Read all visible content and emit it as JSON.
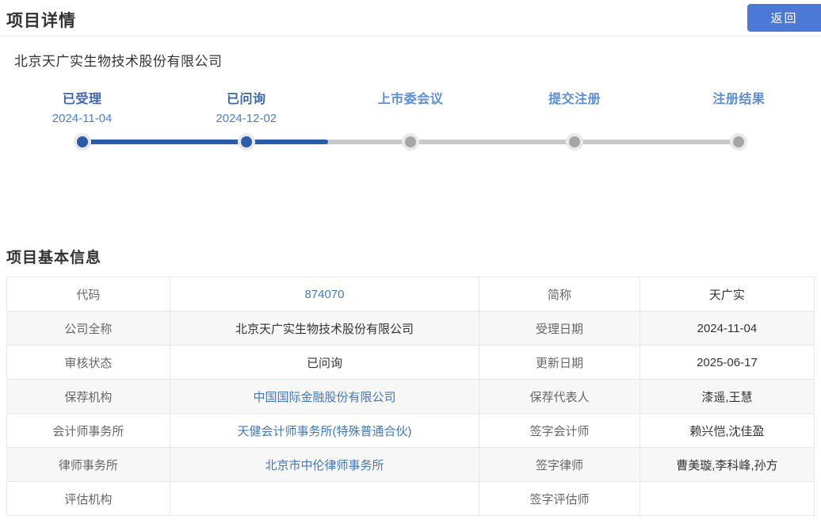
{
  "page": {
    "title": "项目详情",
    "back_label": "返回",
    "company_name": "北京天广实生物技术股份有限公司",
    "section_title": "项目基本信息"
  },
  "timeline": {
    "progress_note": "completed through stage 2, line filled halfway to stage 3",
    "stages": [
      {
        "label": "已受理",
        "date": "2024-11-04",
        "status": "completed"
      },
      {
        "label": "已问询",
        "date": "2024-12-02",
        "status": "completed"
      },
      {
        "label": "上市委会议",
        "date": "",
        "status": "pending"
      },
      {
        "label": "提交注册",
        "date": "",
        "status": "pending"
      },
      {
        "label": "注册结果",
        "date": "",
        "status": "pending"
      }
    ]
  },
  "table": {
    "rows": [
      {
        "label1": "代码",
        "value1": "874070",
        "value1_link": true,
        "label2": "简称",
        "value2": "天广实"
      },
      {
        "label1": "公司全称",
        "value1": "北京天广实生物技术股份有限公司",
        "value1_link": false,
        "label2": "受理日期",
        "value2": "2024-11-04"
      },
      {
        "label1": "审核状态",
        "value1": "已问询",
        "value1_link": false,
        "label2": "更新日期",
        "value2": "2025-06-17"
      },
      {
        "label1": "保荐机构",
        "value1": "中国国际金融股份有限公司",
        "value1_link": true,
        "label2": "保荐代表人",
        "value2": "漆遥,王慧"
      },
      {
        "label1": "会计师事务所",
        "value1": "天健会计师事务所(特殊普通合伙)",
        "value1_link": true,
        "label2": "签字会计师",
        "value2": "赖兴恺,沈佳盈"
      },
      {
        "label1": "律师事务所",
        "value1": "北京市中伦律师事务所",
        "value1_link": true,
        "label2": "签字律师",
        "value2": "曹美璇,李科峰,孙方"
      },
      {
        "label1": "评估机构",
        "value1": "",
        "value1_link": false,
        "label2": "签字评估师",
        "value2": ""
      }
    ]
  },
  "colors": {
    "accent_button_blue": "#4c79d6",
    "timeline_completed_blue": "#2a5caa",
    "timeline_pending_gray": "#a6a6a6",
    "timeline_track_gray": "#c9c9c9",
    "stage_label_completed": "#3a66ae",
    "stage_label_pending": "#5c8ed8",
    "stage_date_blue": "#4a7ecb",
    "table_link_blue": "#4377bd",
    "table_label_gray": "#666666",
    "table_value_dark": "#333333",
    "row_alt_bg": "#f7f7f8"
  }
}
